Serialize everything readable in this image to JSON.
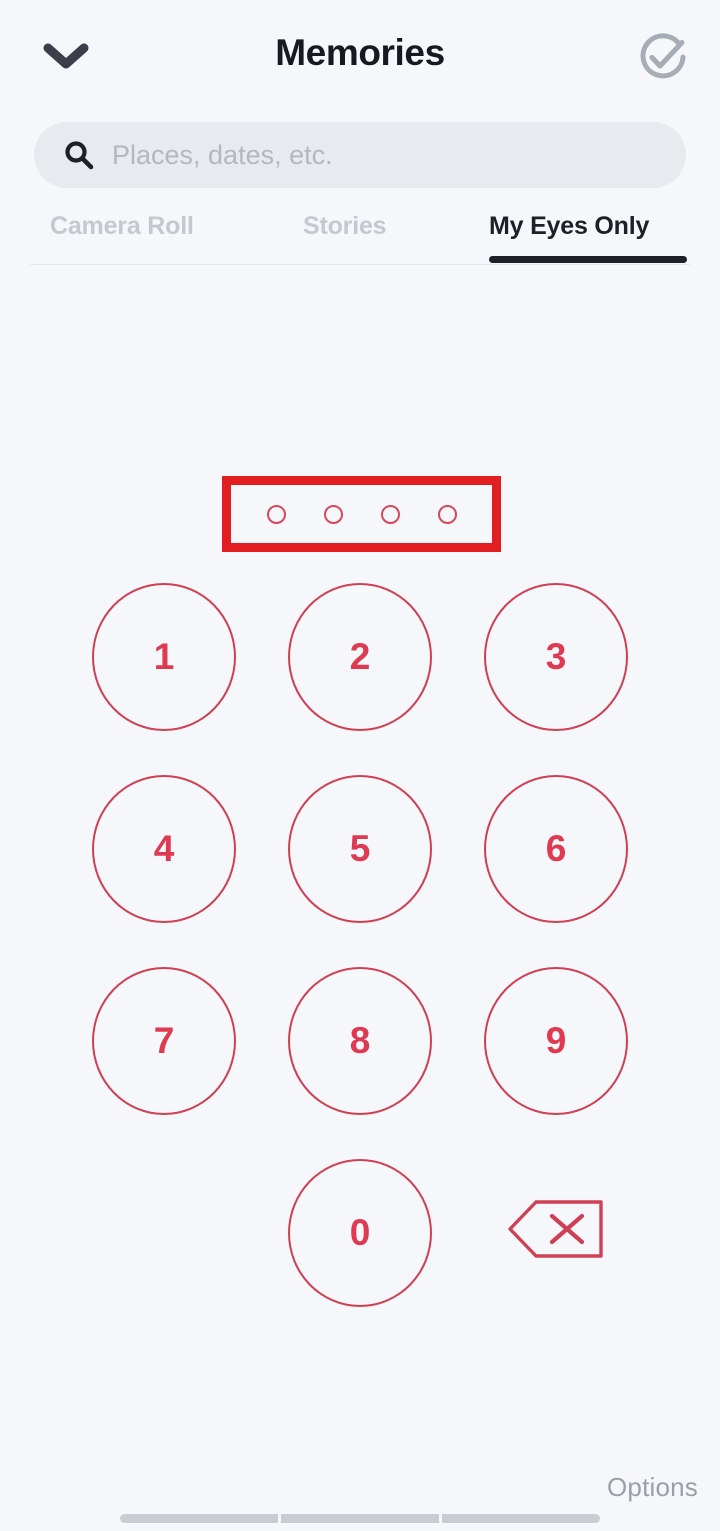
{
  "header": {
    "title": "Memories",
    "back_icon": "chevron-down-icon",
    "confirm_icon": "check-circle-icon"
  },
  "search": {
    "placeholder": "Places, dates, etc.",
    "value": "",
    "icon": "search-icon"
  },
  "tabs": [
    {
      "label": "Camera Roll",
      "active": false
    },
    {
      "label": "Stories",
      "active": false
    },
    {
      "label": "My Eyes Only",
      "active": true
    }
  ],
  "pin": {
    "length": 4,
    "entered": 0,
    "dots": [
      "",
      "",
      "",
      ""
    ],
    "annotation_color": "#e21e21",
    "dot_color": "#d9475c"
  },
  "keypad": {
    "accent_color": "#e03a52",
    "border_color": "#cf4055",
    "rows": [
      [
        {
          "label": "1",
          "type": "digit"
        },
        {
          "label": "2",
          "type": "digit"
        },
        {
          "label": "3",
          "type": "digit"
        }
      ],
      [
        {
          "label": "4",
          "type": "digit"
        },
        {
          "label": "5",
          "type": "digit"
        },
        {
          "label": "6",
          "type": "digit"
        }
      ],
      [
        {
          "label": "7",
          "type": "digit"
        },
        {
          "label": "8",
          "type": "digit"
        },
        {
          "label": "9",
          "type": "digit"
        }
      ],
      [
        {
          "label": "",
          "type": "spacer"
        },
        {
          "label": "0",
          "type": "digit"
        },
        {
          "label": "",
          "type": "backspace",
          "icon": "backspace-delete-icon"
        }
      ]
    ]
  },
  "footer": {
    "options_label": "Options"
  },
  "colors": {
    "background": "#f5f7fa",
    "search_background": "#e7eaee",
    "text_dark": "#16191f",
    "text_muted": "#c4c9d0",
    "accent_red": "#e03a52",
    "annotation_red": "#e21e21"
  }
}
